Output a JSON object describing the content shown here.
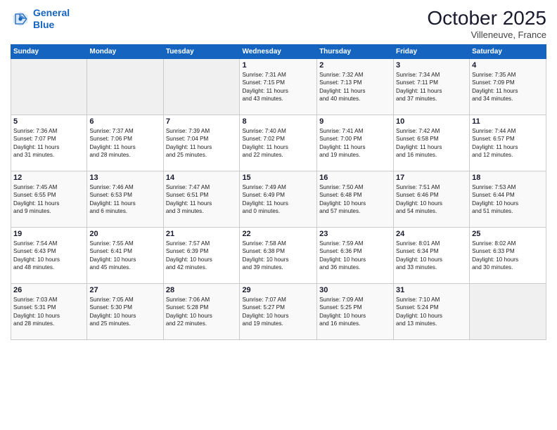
{
  "header": {
    "logo_line1": "General",
    "logo_line2": "Blue",
    "month": "October 2025",
    "location": "Villeneuve, France"
  },
  "weekdays": [
    "Sunday",
    "Monday",
    "Tuesday",
    "Wednesday",
    "Thursday",
    "Friday",
    "Saturday"
  ],
  "weeks": [
    [
      {
        "day": "",
        "info": ""
      },
      {
        "day": "",
        "info": ""
      },
      {
        "day": "",
        "info": ""
      },
      {
        "day": "1",
        "info": "Sunrise: 7:31 AM\nSunset: 7:15 PM\nDaylight: 11 hours\nand 43 minutes."
      },
      {
        "day": "2",
        "info": "Sunrise: 7:32 AM\nSunset: 7:13 PM\nDaylight: 11 hours\nand 40 minutes."
      },
      {
        "day": "3",
        "info": "Sunrise: 7:34 AM\nSunset: 7:11 PM\nDaylight: 11 hours\nand 37 minutes."
      },
      {
        "day": "4",
        "info": "Sunrise: 7:35 AM\nSunset: 7:09 PM\nDaylight: 11 hours\nand 34 minutes."
      }
    ],
    [
      {
        "day": "5",
        "info": "Sunrise: 7:36 AM\nSunset: 7:07 PM\nDaylight: 11 hours\nand 31 minutes."
      },
      {
        "day": "6",
        "info": "Sunrise: 7:37 AM\nSunset: 7:06 PM\nDaylight: 11 hours\nand 28 minutes."
      },
      {
        "day": "7",
        "info": "Sunrise: 7:39 AM\nSunset: 7:04 PM\nDaylight: 11 hours\nand 25 minutes."
      },
      {
        "day": "8",
        "info": "Sunrise: 7:40 AM\nSunset: 7:02 PM\nDaylight: 11 hours\nand 22 minutes."
      },
      {
        "day": "9",
        "info": "Sunrise: 7:41 AM\nSunset: 7:00 PM\nDaylight: 11 hours\nand 19 minutes."
      },
      {
        "day": "10",
        "info": "Sunrise: 7:42 AM\nSunset: 6:58 PM\nDaylight: 11 hours\nand 16 minutes."
      },
      {
        "day": "11",
        "info": "Sunrise: 7:44 AM\nSunset: 6:57 PM\nDaylight: 11 hours\nand 12 minutes."
      }
    ],
    [
      {
        "day": "12",
        "info": "Sunrise: 7:45 AM\nSunset: 6:55 PM\nDaylight: 11 hours\nand 9 minutes."
      },
      {
        "day": "13",
        "info": "Sunrise: 7:46 AM\nSunset: 6:53 PM\nDaylight: 11 hours\nand 6 minutes."
      },
      {
        "day": "14",
        "info": "Sunrise: 7:47 AM\nSunset: 6:51 PM\nDaylight: 11 hours\nand 3 minutes."
      },
      {
        "day": "15",
        "info": "Sunrise: 7:49 AM\nSunset: 6:49 PM\nDaylight: 11 hours\nand 0 minutes."
      },
      {
        "day": "16",
        "info": "Sunrise: 7:50 AM\nSunset: 6:48 PM\nDaylight: 10 hours\nand 57 minutes."
      },
      {
        "day": "17",
        "info": "Sunrise: 7:51 AM\nSunset: 6:46 PM\nDaylight: 10 hours\nand 54 minutes."
      },
      {
        "day": "18",
        "info": "Sunrise: 7:53 AM\nSunset: 6:44 PM\nDaylight: 10 hours\nand 51 minutes."
      }
    ],
    [
      {
        "day": "19",
        "info": "Sunrise: 7:54 AM\nSunset: 6:43 PM\nDaylight: 10 hours\nand 48 minutes."
      },
      {
        "day": "20",
        "info": "Sunrise: 7:55 AM\nSunset: 6:41 PM\nDaylight: 10 hours\nand 45 minutes."
      },
      {
        "day": "21",
        "info": "Sunrise: 7:57 AM\nSunset: 6:39 PM\nDaylight: 10 hours\nand 42 minutes."
      },
      {
        "day": "22",
        "info": "Sunrise: 7:58 AM\nSunset: 6:38 PM\nDaylight: 10 hours\nand 39 minutes."
      },
      {
        "day": "23",
        "info": "Sunrise: 7:59 AM\nSunset: 6:36 PM\nDaylight: 10 hours\nand 36 minutes."
      },
      {
        "day": "24",
        "info": "Sunrise: 8:01 AM\nSunset: 6:34 PM\nDaylight: 10 hours\nand 33 minutes."
      },
      {
        "day": "25",
        "info": "Sunrise: 8:02 AM\nSunset: 6:33 PM\nDaylight: 10 hours\nand 30 minutes."
      }
    ],
    [
      {
        "day": "26",
        "info": "Sunrise: 7:03 AM\nSunset: 5:31 PM\nDaylight: 10 hours\nand 28 minutes."
      },
      {
        "day": "27",
        "info": "Sunrise: 7:05 AM\nSunset: 5:30 PM\nDaylight: 10 hours\nand 25 minutes."
      },
      {
        "day": "28",
        "info": "Sunrise: 7:06 AM\nSunset: 5:28 PM\nDaylight: 10 hours\nand 22 minutes."
      },
      {
        "day": "29",
        "info": "Sunrise: 7:07 AM\nSunset: 5:27 PM\nDaylight: 10 hours\nand 19 minutes."
      },
      {
        "day": "30",
        "info": "Sunrise: 7:09 AM\nSunset: 5:25 PM\nDaylight: 10 hours\nand 16 minutes."
      },
      {
        "day": "31",
        "info": "Sunrise: 7:10 AM\nSunset: 5:24 PM\nDaylight: 10 hours\nand 13 minutes."
      },
      {
        "day": "",
        "info": ""
      }
    ]
  ]
}
